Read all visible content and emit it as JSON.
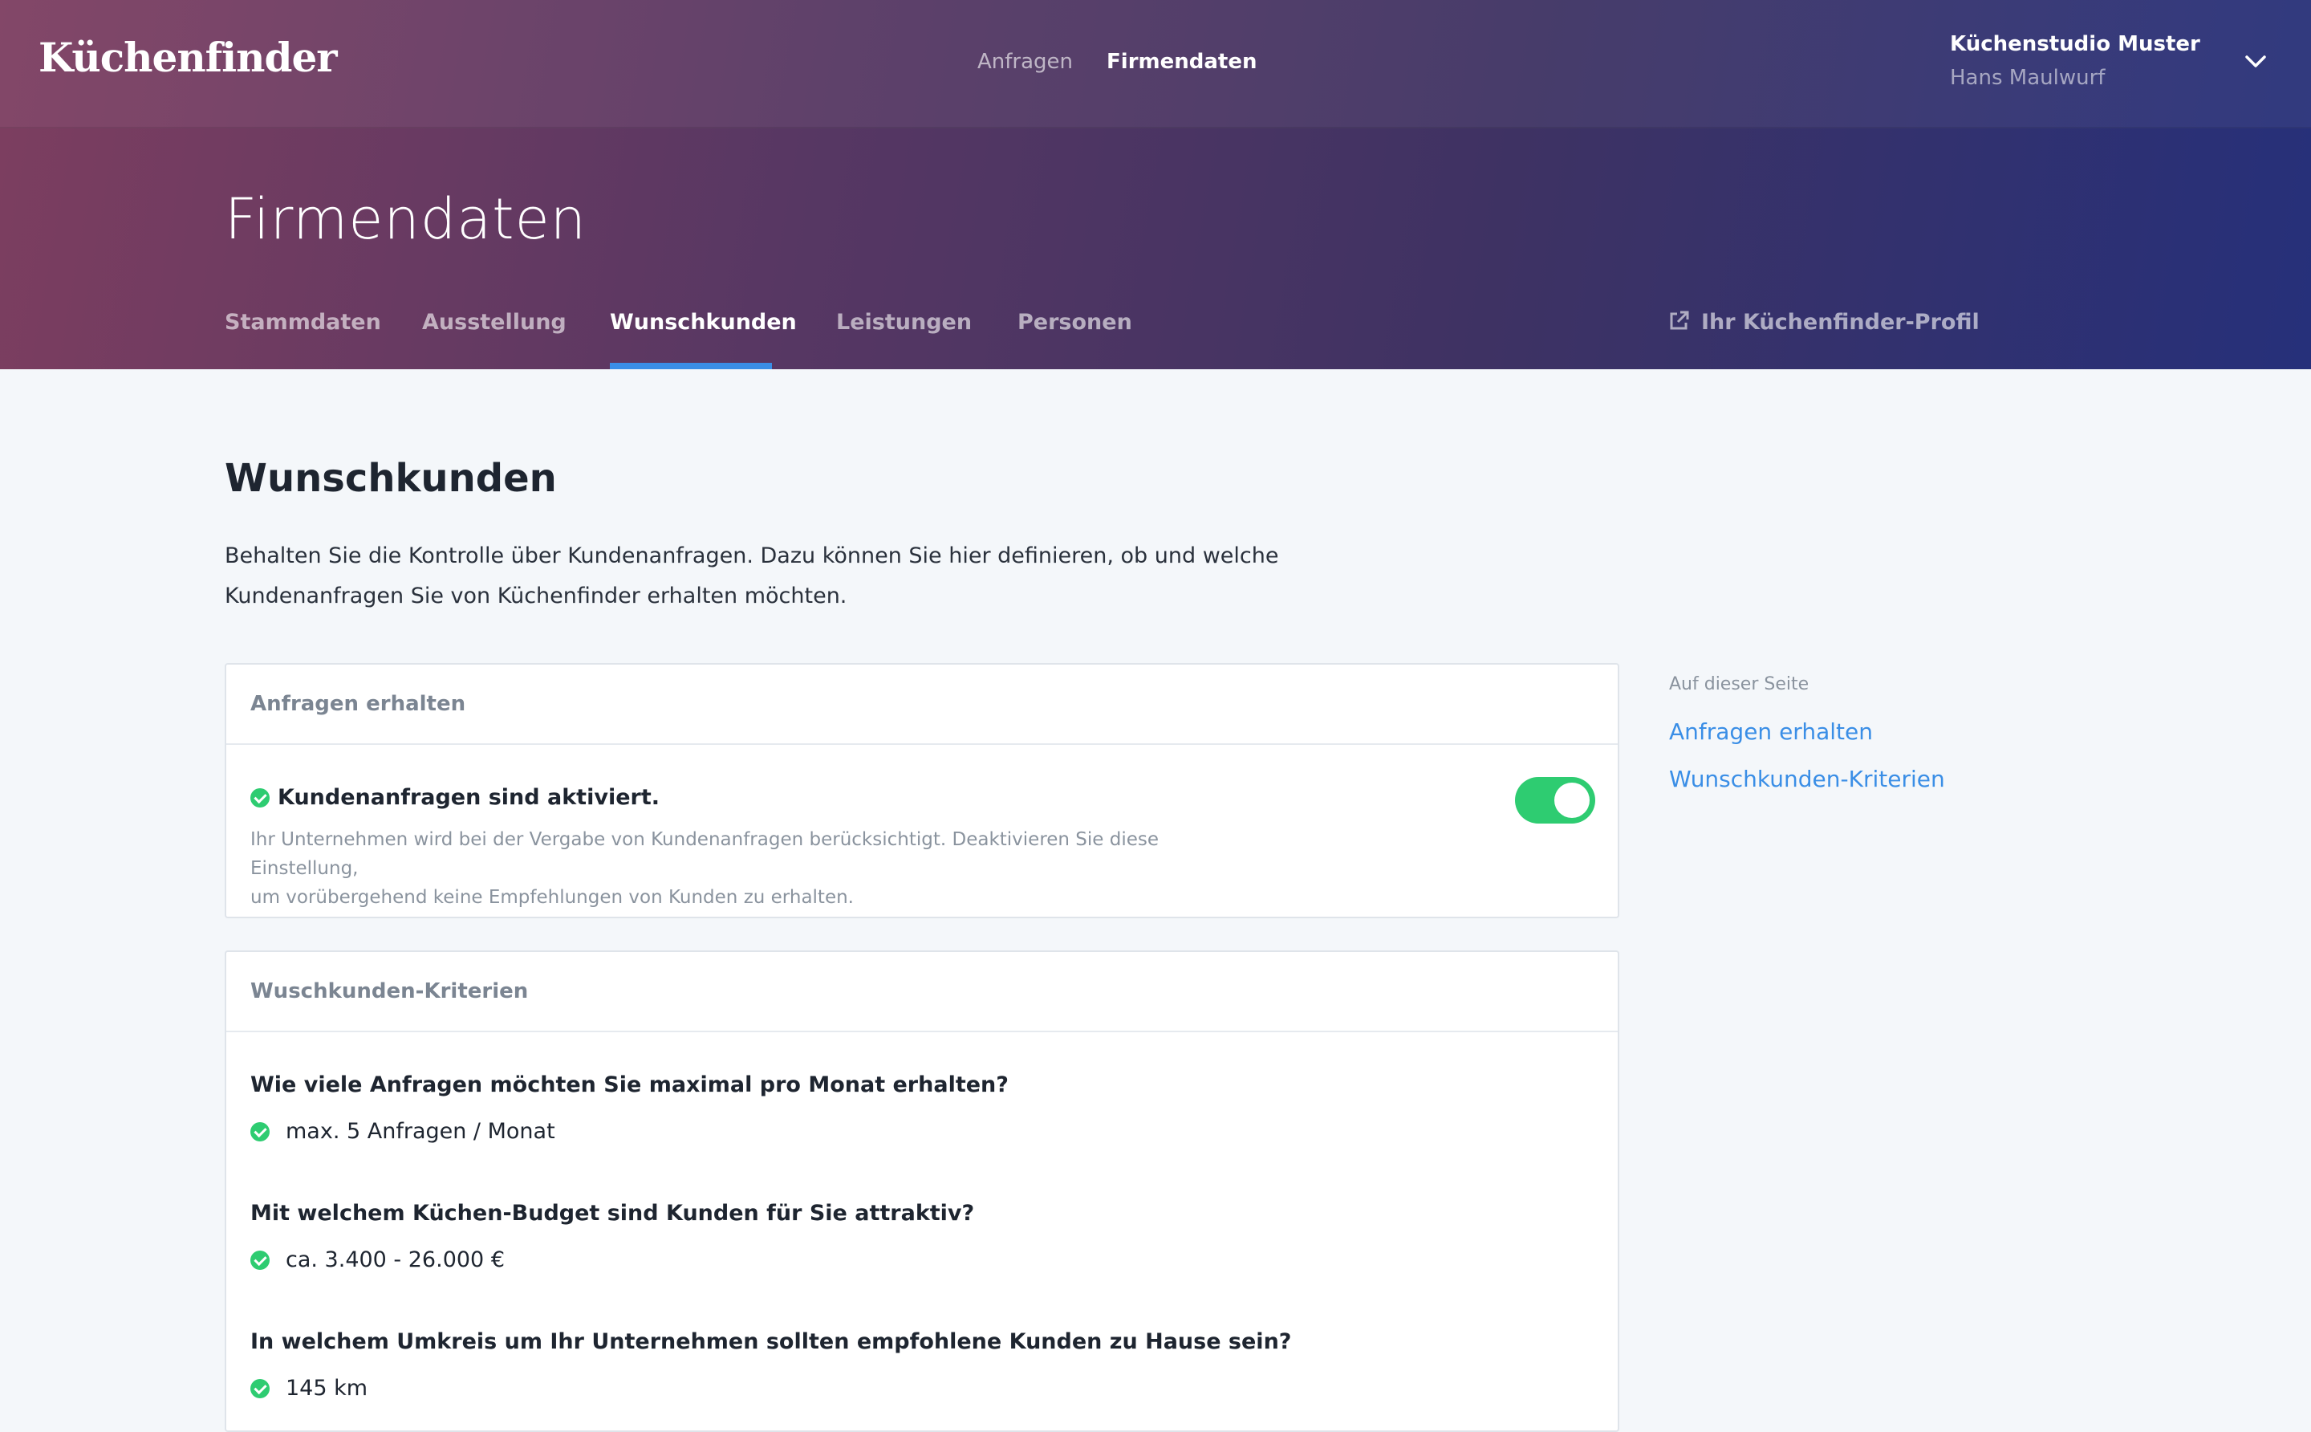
{
  "app": {
    "logo": "Küchenfinder"
  },
  "main_nav": {
    "items": [
      "Anfragen",
      "Firmendaten"
    ],
    "active": "Firmendaten"
  },
  "account": {
    "company": "Küchenstudio Muster",
    "user": "Hans Maulwurf",
    "menu_icon": "chevron-down-icon"
  },
  "page": {
    "title": "Firmendaten"
  },
  "subnav": {
    "tabs": [
      "Stammdaten",
      "Ausstellung",
      "Wunschkunden",
      "Leistungen",
      "Personen"
    ],
    "active": "Wunschkunden",
    "profile_link": "Ihr Küchenfinder-Profil",
    "profile_icon": "external-link-icon"
  },
  "section": {
    "title": "Wunschkunden",
    "intro_line1": "Behalten Sie die Kontrolle über Kundenanfragen. Dazu können Sie hier definieren, ob und welche",
    "intro_line2": "Kundenanfragen Sie von Küchenfinder erhalten möchten."
  },
  "card_requests": {
    "title": "Anfragen erhalten",
    "status": "Kundenanfragen sind aktiviert.",
    "desc_line1": "Ihr Unternehmen wird bei der Vergabe von Kundenanfragen berücksichtigt. Deaktivieren Sie diese Einstellung,",
    "desc_line2": "um vorübergehend keine Empfehlungen von Kunden zu erhalten.",
    "toggle_on": true
  },
  "card_criteria": {
    "title": "Wuschkunden-Kriterien",
    "items": [
      {
        "question": "Wie viele Anfragen möchten Sie maximal pro Monat erhalten?",
        "answer": "max. 5 Anfragen / Monat"
      },
      {
        "question": "Mit welchem Küchen-Budget sind Kunden für Sie attraktiv?",
        "answer": "ca. 3.400 - 26.000 €"
      },
      {
        "question": "In welchem Umkreis um Ihr Unternehmen sollten empfohlene Kunden zu Hause sein?",
        "answer": "145 km"
      }
    ]
  },
  "toc": {
    "label": "Auf dieser Seite",
    "links": [
      "Anfragen erhalten",
      "Wunschkunden-Kriterien"
    ]
  },
  "colors": {
    "accent": "#3a8ee6",
    "success": "#2ecc71",
    "header_gradient_start": "#7d3e60",
    "header_gradient_end": "#26307a"
  }
}
